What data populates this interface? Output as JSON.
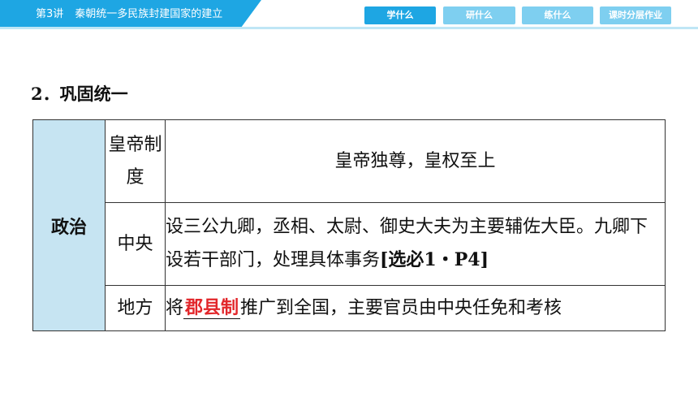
{
  "header": {
    "lesson_number": "第3讲",
    "lesson_title": "秦朝统一多民族封建国家的建立",
    "nav": [
      {
        "label": "学什么",
        "active": true
      },
      {
        "label": "研什么",
        "active": false
      },
      {
        "label": "练什么",
        "active": false
      },
      {
        "label": "课时分层作业",
        "active": false
      }
    ],
    "accent_color": "#1ea6e3",
    "inactive_color": "#7ecff0"
  },
  "section": {
    "title": "2．巩固统一"
  },
  "table": {
    "category": "政治",
    "category_bg": "#c6e4f2",
    "rows": [
      {
        "label": "皇帝制度",
        "content": "皇帝独尊，皇权至上"
      },
      {
        "label": "中央",
        "content": "设三公九卿，丞相、太尉、御史大夫为主要辅佐大臣。九卿下设若干部门，处理具体事务",
        "ref": "[选必1・P4]"
      },
      {
        "label": "地方",
        "prefix": "将",
        "blank": "郡县制",
        "suffix": "推广到全国，主要官员由中央任免和考核"
      }
    ],
    "blank_color": "#e2262a"
  }
}
